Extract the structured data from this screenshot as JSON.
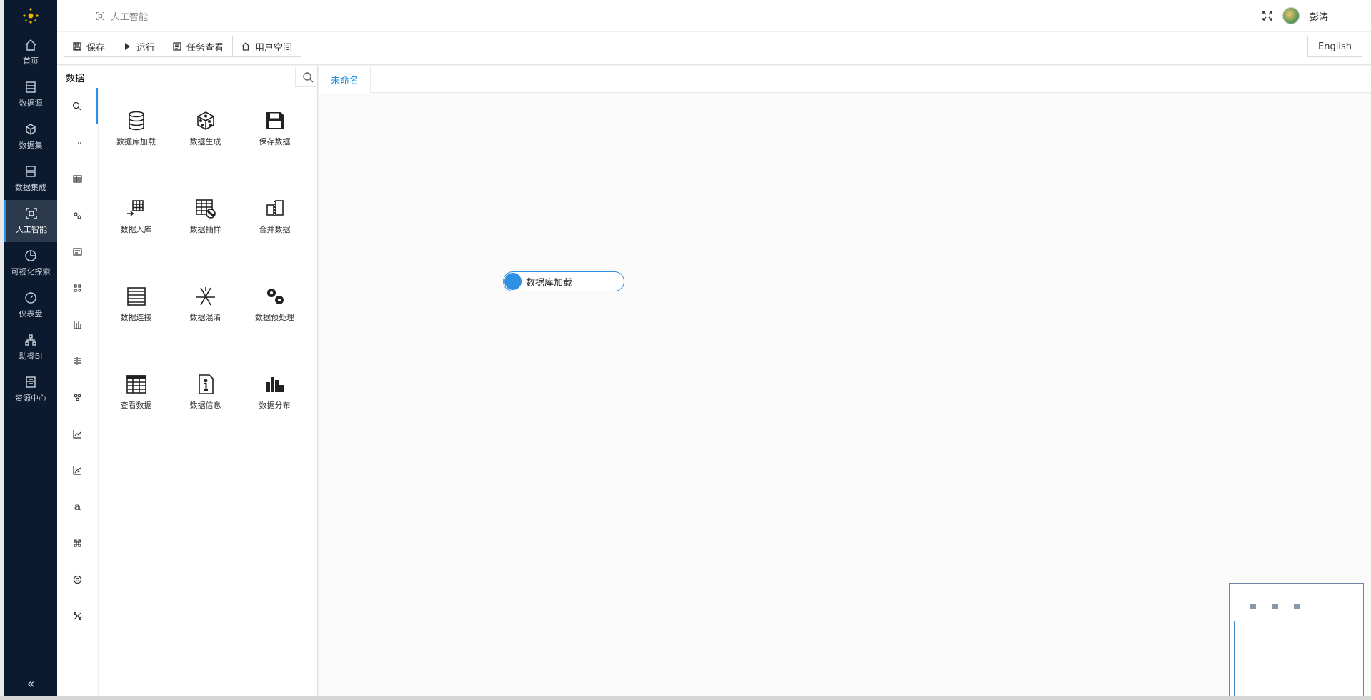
{
  "sidebar": {
    "items": [
      {
        "label": "首页",
        "icon": "home-icon"
      },
      {
        "label": "数据源",
        "icon": "datasource-icon"
      },
      {
        "label": "数据集",
        "icon": "cube-icon"
      },
      {
        "label": "数据集成",
        "icon": "server-icon"
      },
      {
        "label": "人工智能",
        "icon": "ai-icon",
        "active": true
      },
      {
        "label": "可视化探索",
        "icon": "pie-icon"
      },
      {
        "label": "仪表盘",
        "icon": "gauge-icon"
      },
      {
        "label": "助睿BI",
        "icon": "org-icon"
      },
      {
        "label": "资源中心",
        "icon": "resource-icon"
      }
    ],
    "collapse": "«"
  },
  "header": {
    "breadcrumb": "人工智能",
    "username": "彭涛"
  },
  "toolbar": {
    "save": "保存",
    "run": "运行",
    "tasks": "任务查看",
    "userspace": "用户空间",
    "language": "English"
  },
  "panel": {
    "search_value": "数据",
    "components": [
      {
        "label": "数据库加载",
        "icon": "database-icon"
      },
      {
        "label": "数据生成",
        "icon": "dice-icon"
      },
      {
        "label": "保存数据",
        "icon": "floppy-icon"
      },
      {
        "label": "数据入库",
        "icon": "import-grid-icon"
      },
      {
        "label": "数据抽样",
        "icon": "sample-table-icon"
      },
      {
        "label": "合并数据",
        "icon": "merge-icon"
      },
      {
        "label": "数据连接",
        "icon": "join-table-icon"
      },
      {
        "label": "数据混淆",
        "icon": "shuffle-icon"
      },
      {
        "label": "数据预处理",
        "icon": "gears-icon"
      },
      {
        "label": "查看数据",
        "icon": "table-view-icon"
      },
      {
        "label": "数据信息",
        "icon": "info-doc-icon"
      },
      {
        "label": "数据分布",
        "icon": "bar-chart-icon"
      }
    ],
    "category_letter": "a"
  },
  "canvas": {
    "tab": "未命名",
    "node_label": "数据库加载"
  },
  "colors": {
    "sidebar_bg": "#0b1a2e",
    "accent": "#2f8fe3"
  }
}
